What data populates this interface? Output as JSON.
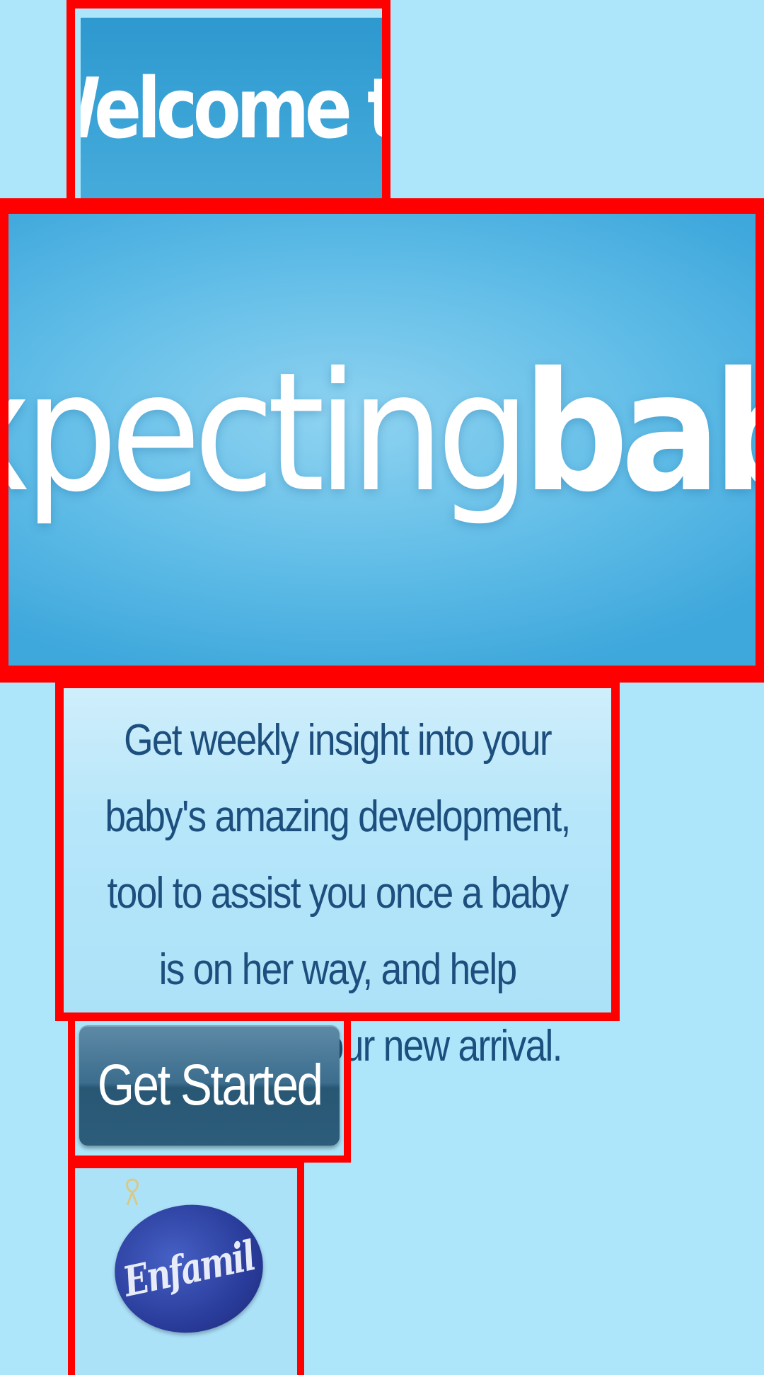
{
  "welcome": {
    "title": "Welcome to"
  },
  "logo": {
    "word_light": "expecting",
    "word_bold": "baby"
  },
  "description": {
    "text": "Get weekly insight into your baby's amazing development, tool to assist you once a baby is on her way, and help announcing your new arrival."
  },
  "actions": {
    "get_started_label": "Get Started"
  },
  "brand": {
    "name": "Enfamil"
  },
  "colors": {
    "background": "#ade6fb",
    "highlight_border": "#ff0000",
    "banner_blue": "#3ea7dc",
    "description_text": "#1d4f7e",
    "button": "#2c5d7b"
  }
}
